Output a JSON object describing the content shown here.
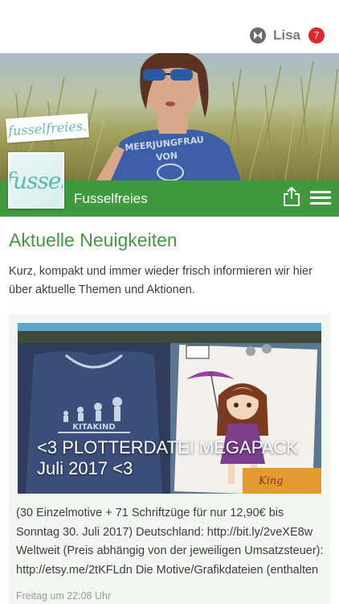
{
  "header": {
    "user_name": "Lisa",
    "notification_count": "7",
    "icon": "app-logo-icon"
  },
  "hero": {
    "tag_text": "fusselfreies."
  },
  "channel": {
    "logo_text": "fussel",
    "name": "Fusselfreies",
    "share_icon": "share-icon",
    "menu_icon": "hamburger-menu-icon"
  },
  "section": {
    "title": "Aktuelle Neuigkeiten",
    "description": "Kurz, kompakt und immer wieder frisch informieren wir hier über aktuelle Themen und Aktionen."
  },
  "post": {
    "image_title": "<3 PLOTTERDATEI MEGAPACK Juli 2017 <3",
    "image_shirt_text": "KITAKIND",
    "image_card_text": "King",
    "body": "(30 Einzelmotive + 71 Schriftzüge für nur 12,90€ bis Sonntag 30. Juli 2017) Deutschland: http://bit.ly/2veXE8w Weltweit (Preis abhängig von der jeweiligen Umsatzsteuer): http://etsy.me/2tKFLdn Die Motive/Grafikdateien (enthalten",
    "timestamp": "Freitag um 22:08 Uhr"
  },
  "colors": {
    "brand_green": "#3f9a3e",
    "badge_red": "#e0262b",
    "card_bg": "#f1f6f1"
  }
}
